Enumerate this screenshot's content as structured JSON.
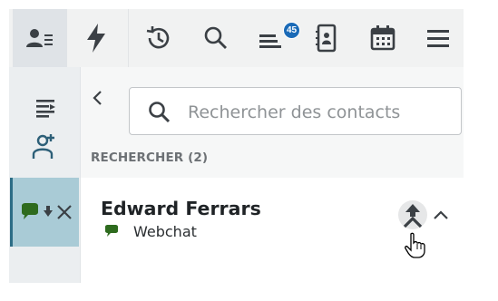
{
  "toolbar": {
    "items": [
      {
        "icon": "contacts-icon",
        "active": true
      },
      {
        "icon": "lightning-icon"
      },
      {
        "icon": "history-icon"
      },
      {
        "icon": "search-icon"
      },
      {
        "icon": "queue-icon",
        "badge": "45"
      },
      {
        "icon": "address-book-icon"
      },
      {
        "icon": "calendar-icon"
      },
      {
        "icon": "menu-icon"
      }
    ]
  },
  "rail": {
    "items": [
      {
        "icon": "list-icon"
      },
      {
        "icon": "add-contact-icon"
      },
      {
        "icon": "conversation-icon",
        "secondary_icon": "arrow-icon",
        "close_icon": "close-icon",
        "active": true
      }
    ]
  },
  "search": {
    "placeholder": "Rechercher des contacts",
    "value": ""
  },
  "results": {
    "section_title": "RECHERCHER (2)",
    "contacts": [
      {
        "name": "Edward Ferrars",
        "channel": "Webchat",
        "channel_icon": "chat-icon"
      }
    ]
  },
  "colors": {
    "accent": "#1a6ab7",
    "rail_active": "#a9cbd6",
    "rail_active_border": "#2d6d86",
    "webchat_green": "#2e6b1e",
    "icon": "#3b4045"
  }
}
